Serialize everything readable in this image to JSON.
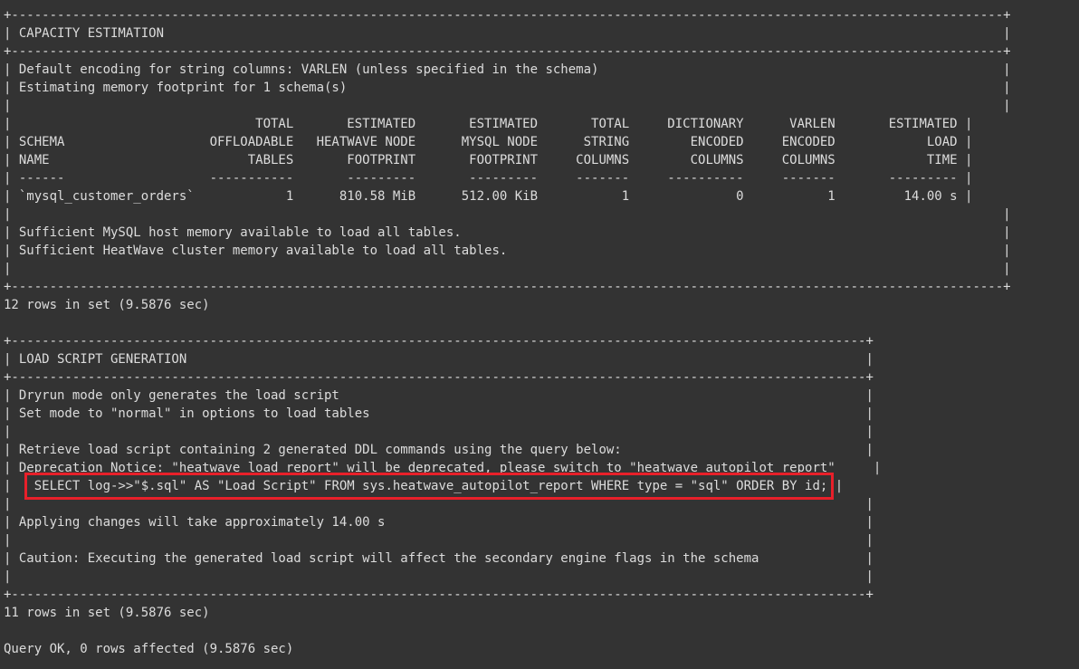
{
  "terminal": {
    "capacity_block": [
      "+----------------------------------------------------------------------------------------------------------------------------------+",
      "| CAPACITY ESTIMATION                                                                                                              |",
      "+----------------------------------------------------------------------------------------------------------------------------------+",
      "| Default encoding for string columns: VARLEN (unless specified in the schema)                                                     |",
      "| Estimating memory footprint for 1 schema(s)                                                                                      |",
      "|                                                                                                                                  |",
      "|                                TOTAL       ESTIMATED       ESTIMATED       TOTAL     DICTIONARY      VARLEN       ESTIMATED |",
      "| SCHEMA                   OFFLOADABLE   HEATWAVE NODE      MYSQL NODE      STRING        ENCODED     ENCODED            LOAD |",
      "| NAME                          TABLES       FOOTPRINT       FOOTPRINT     COLUMNS        COLUMNS     COLUMNS            TIME |",
      "| ------                   -----------       ---------       ---------     -------     ----------     -------       --------- |",
      "| `mysql_customer_orders`            1      810.58 MiB      512.00 KiB           1              0           1         14.00 s |",
      "|                                                                                                                                  |",
      "| Sufficient MySQL host memory available to load all tables.                                                                       |",
      "| Sufficient HeatWave cluster memory available to load all tables.                                                                 |",
      "|                                                                                                                                  |",
      "+----------------------------------------------------------------------------------------------------------------------------------+"
    ],
    "capacity_rows": "12 rows in set (9.5876 sec)",
    "load_block_top": [
      "+----------------------------------------------------------------------------------------------------------------+",
      "| LOAD SCRIPT GENERATION                                                                                         |",
      "+----------------------------------------------------------------------------------------------------------------+",
      "| Dryrun mode only generates the load script                                                                     |",
      "| Set mode to \"normal\" in options to load tables                                                                 |",
      "|                                                                                                                |",
      "| Retrieve load script containing 2 generated DDL commands using the query below:                                |",
      "| Deprecation Notice: \"heatwave_load_report\" will be deprecated, please switch to \"heatwave_autopilot_report\"     |"
    ],
    "sql_prefix": "|   ",
    "sql_query": "SELECT log->>\"$.sql\" AS \"Load Script\" FROM sys.heatwave_autopilot_report WHERE type = \"sql\" ORDER BY id;",
    "sql_suffix": " |",
    "load_block_bottom": [
      "|                                                                                                                |",
      "| Applying changes will take approximately 14.00 s                                                               |",
      "|                                                                                                                |",
      "| Caution: Executing the generated load script will affect the secondary engine flags in the schema              |",
      "|                                                                                                                |",
      "+----------------------------------------------------------------------------------------------------------------+"
    ],
    "load_rows": "11 rows in set (9.5876 sec)",
    "query_ok": "Query OK, 0 rows affected (9.5876 sec)"
  },
  "colors": {
    "background": "#333333",
    "text": "#dcdcdc",
    "highlight": "#e8202a"
  }
}
